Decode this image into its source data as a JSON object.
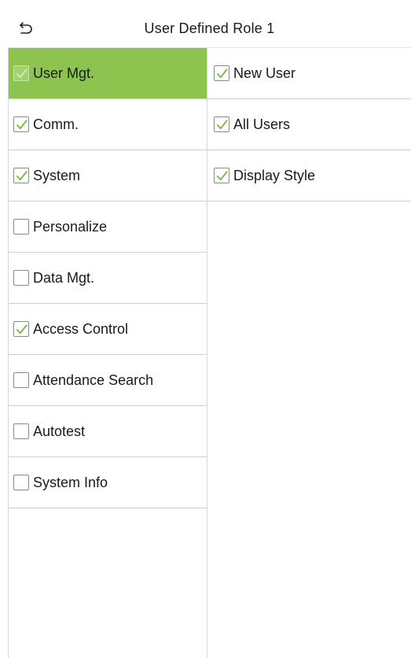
{
  "header": {
    "title": "User Defined Role 1",
    "back_icon": "back-arrow-icon"
  },
  "colors": {
    "selected_background": "#8cc44f",
    "check_mark": "#6ab52e"
  },
  "left_menu": {
    "items": [
      {
        "label": "User Mgt.",
        "checked": true,
        "selected": true
      },
      {
        "label": "Comm.",
        "checked": true,
        "selected": false
      },
      {
        "label": "System",
        "checked": true,
        "selected": false
      },
      {
        "label": "Personalize",
        "checked": false,
        "selected": false
      },
      {
        "label": "Data Mgt.",
        "checked": false,
        "selected": false
      },
      {
        "label": "Access Control",
        "checked": true,
        "selected": false
      },
      {
        "label": "Attendance Search",
        "checked": false,
        "selected": false
      },
      {
        "label": "Autotest",
        "checked": false,
        "selected": false
      },
      {
        "label": "System Info",
        "checked": false,
        "selected": false
      }
    ]
  },
  "right_menu": {
    "items": [
      {
        "label": "New User",
        "checked": true
      },
      {
        "label": "All Users",
        "checked": true
      },
      {
        "label": "Display Style",
        "checked": true
      }
    ]
  }
}
